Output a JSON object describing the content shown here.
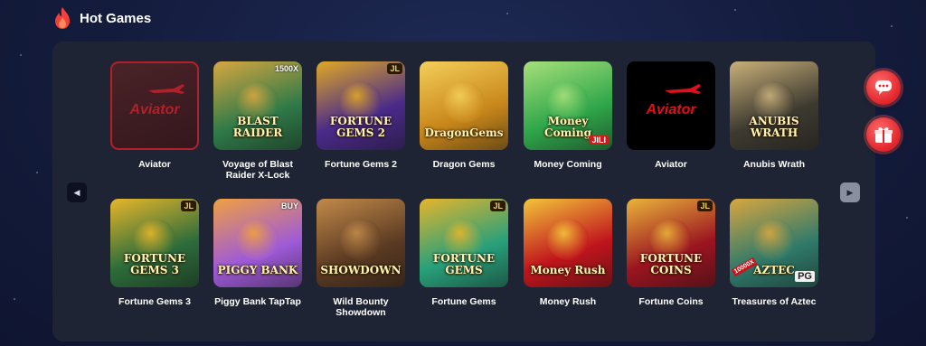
{
  "header": {
    "title": "Hot Games",
    "icon": "flame-icon"
  },
  "nav": {
    "prev_icon": "◀",
    "next_icon": "▶"
  },
  "rows": [
    [
      {
        "name": "Aviator",
        "logo": "Aviator",
        "style": "aviator-dim",
        "bg": "#3a1a1f",
        "accent": "#b3202a"
      },
      {
        "name": "Voyage of Blast Raider X-Lock",
        "logo": "BLAST RAIDER",
        "corner": "1500X",
        "bg": "#2f7a48",
        "accent": "#d8a640"
      },
      {
        "name": "Fortune Gems 2",
        "logo": "FORTUNE GEMS 2",
        "jl": "JL",
        "bg": "#4a2a8a",
        "accent": "#e0a824"
      },
      {
        "name": "Dragon Gems",
        "logo": "DragonGems",
        "bg": "#c8861a",
        "accent": "#f4cf5a"
      },
      {
        "name": "Money Coming",
        "logo": "Money Coming",
        "tag": "JILI",
        "bg": "#2fa64a",
        "accent": "#a6e07a"
      },
      {
        "name": "Aviator",
        "logo": "Aviator",
        "style": "aviator-dark",
        "bg": "#000000",
        "accent": "#e0101a"
      },
      {
        "name": "Anubis Wrath",
        "logo": "ANUBIS WRATH",
        "bg": "#3d3a30",
        "accent": "#c9b07a"
      }
    ],
    [
      {
        "name": "Fortune Gems 3",
        "logo": "FORTUNE GEMS 3",
        "jl": "JL",
        "bg": "#2c6c3a",
        "accent": "#e8b62a"
      },
      {
        "name": "Piggy Bank TapTap",
        "logo": "PIGGY BANK",
        "corner": "BUY",
        "bg": "#9f5ad8",
        "accent": "#f0a040"
      },
      {
        "name": "Wild Bounty Showdown",
        "logo": "SHOWDOWN",
        "bg": "#5a3a22",
        "accent": "#c28a4a"
      },
      {
        "name": "Fortune Gems",
        "logo": "FORTUNE GEMS",
        "jl": "JL",
        "bg": "#28a07a",
        "accent": "#e6b52c"
      },
      {
        "name": "Money Rush",
        "logo": "Money Rush",
        "bg": "#c0141c",
        "accent": "#f3c53a"
      },
      {
        "name": "Fortune Coins",
        "logo": "FORTUNE COINS",
        "jl": "JL",
        "bg": "#9b1420",
        "accent": "#e9b43a"
      },
      {
        "name": "Treasures of Aztec",
        "logo": "AZTEC",
        "tag": "PG",
        "side": "10000X",
        "bg": "#2f7a6a",
        "accent": "#d9a640"
      }
    ]
  ],
  "floating": [
    {
      "name": "support-chat-button",
      "icon": "chat-icon"
    },
    {
      "name": "promotions-button",
      "icon": "gift-icon"
    }
  ]
}
